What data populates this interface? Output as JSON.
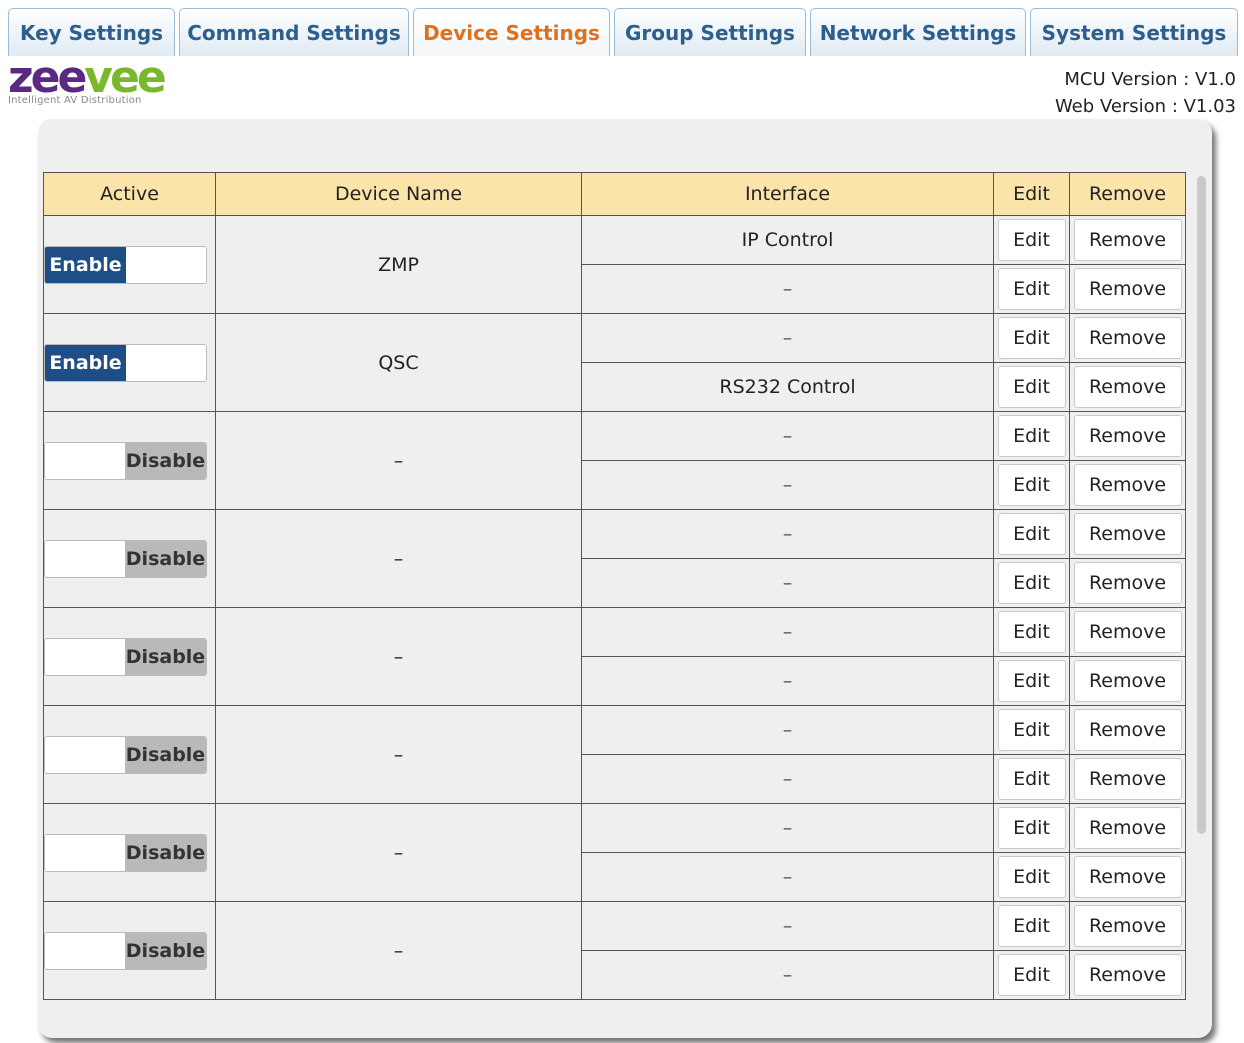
{
  "tabs": [
    {
      "label": "Key Settings",
      "active": false
    },
    {
      "label": "Command Settings",
      "active": false
    },
    {
      "label": "Device Settings",
      "active": true
    },
    {
      "label": "Group Settings",
      "active": false
    },
    {
      "label": "Network Settings",
      "active": false
    },
    {
      "label": "System Settings",
      "active": false
    }
  ],
  "logo": {
    "word": "zeevee",
    "tagline": "Intelligent AV Distribution"
  },
  "versions": {
    "mcu": "MCU Version : V1.0",
    "web": "Web Version : V1.03"
  },
  "table": {
    "headers": {
      "active": "Active",
      "name": "Device Name",
      "interface": "Interface",
      "edit": "Edit",
      "remove": "Remove"
    },
    "edit_label": "Edit",
    "remove_label": "Remove",
    "enable_label": "Enable",
    "disable_label": "Disable",
    "devices": [
      {
        "active": true,
        "name": "ZMP",
        "interfaces": [
          "IP Control",
          "–"
        ]
      },
      {
        "active": true,
        "name": "QSC",
        "interfaces": [
          "–",
          "RS232 Control"
        ]
      },
      {
        "active": false,
        "name": "–",
        "interfaces": [
          "–",
          "–"
        ]
      },
      {
        "active": false,
        "name": "–",
        "interfaces": [
          "–",
          "–"
        ]
      },
      {
        "active": false,
        "name": "–",
        "interfaces": [
          "–",
          "–"
        ]
      },
      {
        "active": false,
        "name": "–",
        "interfaces": [
          "–",
          "–"
        ]
      },
      {
        "active": false,
        "name": "–",
        "interfaces": [
          "–",
          "–"
        ]
      },
      {
        "active": false,
        "name": "–",
        "interfaces": [
          "–",
          "–"
        ]
      }
    ]
  },
  "colors": {
    "tab_text": "#2c5e8e",
    "tab_active_text": "#e0701c",
    "header_bg": "#fbe4a9",
    "enable_bg": "#1f4e86",
    "disable_bg": "#b9b9b9"
  }
}
